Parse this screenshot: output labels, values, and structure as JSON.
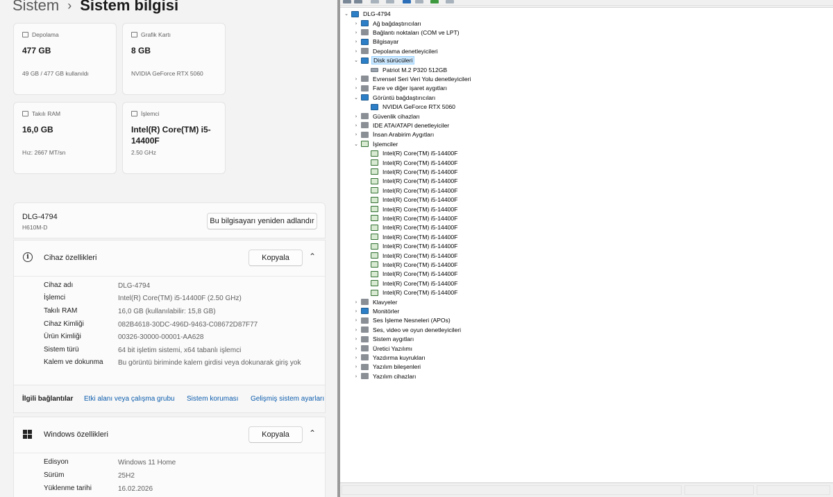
{
  "settings": {
    "breadcrumb": {
      "parent": "Sistem",
      "separator": "›",
      "current": "Sistem bilgisi"
    },
    "cards": [
      {
        "label": "Depolama",
        "value": "477 GB",
        "sub": "49 GB / 477 GB kullanıldı",
        "icon": "storage-icon"
      },
      {
        "label": "Grafik Kartı",
        "value": "8 GB",
        "sub": "NVIDIA GeForce RTX 5060",
        "icon": "graphics-card-icon"
      },
      {
        "label": "Takılı RAM",
        "value": "16,0 GB",
        "sub": "Hız: 2667 MT/sn",
        "icon": "ram-icon"
      },
      {
        "label": "İşlemci",
        "value": "Intel(R) Core(TM) i5-14400F",
        "sub": "2.50 GHz",
        "icon": "processor-icon"
      }
    ],
    "device": {
      "name": "DLG-4794",
      "model": "H610M-D",
      "rename_label": "Bu bilgisayarı yeniden adlandır"
    },
    "device_specs": {
      "title": "Cihaz özellikleri",
      "copy_label": "Kopyala",
      "rows": [
        {
          "key": "Cihaz adı",
          "value": "DLG-4794"
        },
        {
          "key": "İşlemci",
          "value": "Intel(R) Core(TM) i5-14400F (2.50 GHz)"
        },
        {
          "key": "Takılı RAM",
          "value": "16,0 GB (kullanılabilir: 15,8 GB)"
        },
        {
          "key": "Cihaz Kimliği",
          "value": "082B4618-30DC-496D-9463-C08672D87F77"
        },
        {
          "key": "Ürün Kimliği",
          "value": "00326-30000-00001-AA628"
        },
        {
          "key": "Sistem türü",
          "value": "64 bit işletim sistemi, x64 tabanlı işlemci"
        },
        {
          "key": "Kalem ve dokunma",
          "value": "Bu görüntü biriminde kalem girdisi veya dokunarak giriş yok"
        }
      ]
    },
    "related": {
      "label": "İlgili bağlantılar",
      "links": [
        "Etki alanı veya çalışma grubu",
        "Sistem koruması",
        "Gelişmiş sistem ayarları"
      ]
    },
    "windows_specs": {
      "title": "Windows özellikleri",
      "copy_label": "Kopyala",
      "rows": [
        {
          "key": "Edisyon",
          "value": "Windows 11 Home"
        },
        {
          "key": "Sürüm",
          "value": "25H2"
        },
        {
          "key": "Yüklenme tarihi",
          "value": "16.02.2026"
        }
      ]
    }
  },
  "device_manager": {
    "root": "DLG-4794",
    "categories": [
      {
        "label": "Ağ bağdaştırıcıları",
        "expanded": false,
        "icon": "network-adapter-icon"
      },
      {
        "label": "Bağlantı noktaları (COM ve LPT)",
        "expanded": false,
        "icon": "port-icon"
      },
      {
        "label": "Bilgisayar",
        "expanded": false,
        "icon": "computer-icon"
      },
      {
        "label": "Depolama denetleyicileri",
        "expanded": false,
        "icon": "storage-controller-icon"
      },
      {
        "label": "Disk sürücüleri",
        "expanded": true,
        "selected": true,
        "icon": "disk-drive-icon",
        "children": [
          "Patriot M.2 P320 512GB"
        ]
      },
      {
        "label": "Evrensel Seri Veri Yolu denetleyicileri",
        "expanded": false,
        "icon": "usb-icon"
      },
      {
        "label": "Fare ve diğer işaret aygıtları",
        "expanded": false,
        "icon": "mouse-icon"
      },
      {
        "label": "Görüntü bağdaştırıcıları",
        "expanded": true,
        "icon": "display-adapter-icon",
        "children": [
          "NVIDIA GeForce RTX 5060"
        ]
      },
      {
        "label": "Güvenlik cihazları",
        "expanded": false,
        "icon": "security-device-icon"
      },
      {
        "label": "IDE ATA/ATAPI denetleyiciler",
        "expanded": false,
        "icon": "ide-icon"
      },
      {
        "label": "İnsan Arabirim Aygıtları",
        "expanded": false,
        "icon": "hid-icon"
      },
      {
        "label": "İşlemciler",
        "expanded": true,
        "icon": "processor-icon",
        "children": [
          "Intel(R) Core(TM) i5-14400F",
          "Intel(R) Core(TM) i5-14400F",
          "Intel(R) Core(TM) i5-14400F",
          "Intel(R) Core(TM) i5-14400F",
          "Intel(R) Core(TM) i5-14400F",
          "Intel(R) Core(TM) i5-14400F",
          "Intel(R) Core(TM) i5-14400F",
          "Intel(R) Core(TM) i5-14400F",
          "Intel(R) Core(TM) i5-14400F",
          "Intel(R) Core(TM) i5-14400F",
          "Intel(R) Core(TM) i5-14400F",
          "Intel(R) Core(TM) i5-14400F",
          "Intel(R) Core(TM) i5-14400F",
          "Intel(R) Core(TM) i5-14400F",
          "Intel(R) Core(TM) i5-14400F",
          "Intel(R) Core(TM) i5-14400F"
        ]
      },
      {
        "label": "Klavyeler",
        "expanded": false,
        "icon": "keyboard-icon"
      },
      {
        "label": "Monitörler",
        "expanded": false,
        "icon": "monitor-icon"
      },
      {
        "label": "Ses İşleme Nesneleri (APOs)",
        "expanded": false,
        "icon": "audio-processing-icon"
      },
      {
        "label": "Ses, video ve oyun denetleyicileri",
        "expanded": false,
        "icon": "sound-icon"
      },
      {
        "label": "Sistem aygıtları",
        "expanded": false,
        "icon": "system-device-icon"
      },
      {
        "label": "Üretici Yazılımı",
        "expanded": false,
        "icon": "firmware-icon"
      },
      {
        "label": "Yazdırma kuyrukları",
        "expanded": false,
        "icon": "print-queue-icon"
      },
      {
        "label": "Yazılım bileşenleri",
        "expanded": false,
        "icon": "software-component-icon"
      },
      {
        "label": "Yazılım cihazları",
        "expanded": false,
        "icon": "software-device-icon"
      }
    ]
  },
  "colors": {
    "accent": "#0b5cad",
    "selection": "#cce8ff",
    "window_bg": "#f3f3f3"
  }
}
